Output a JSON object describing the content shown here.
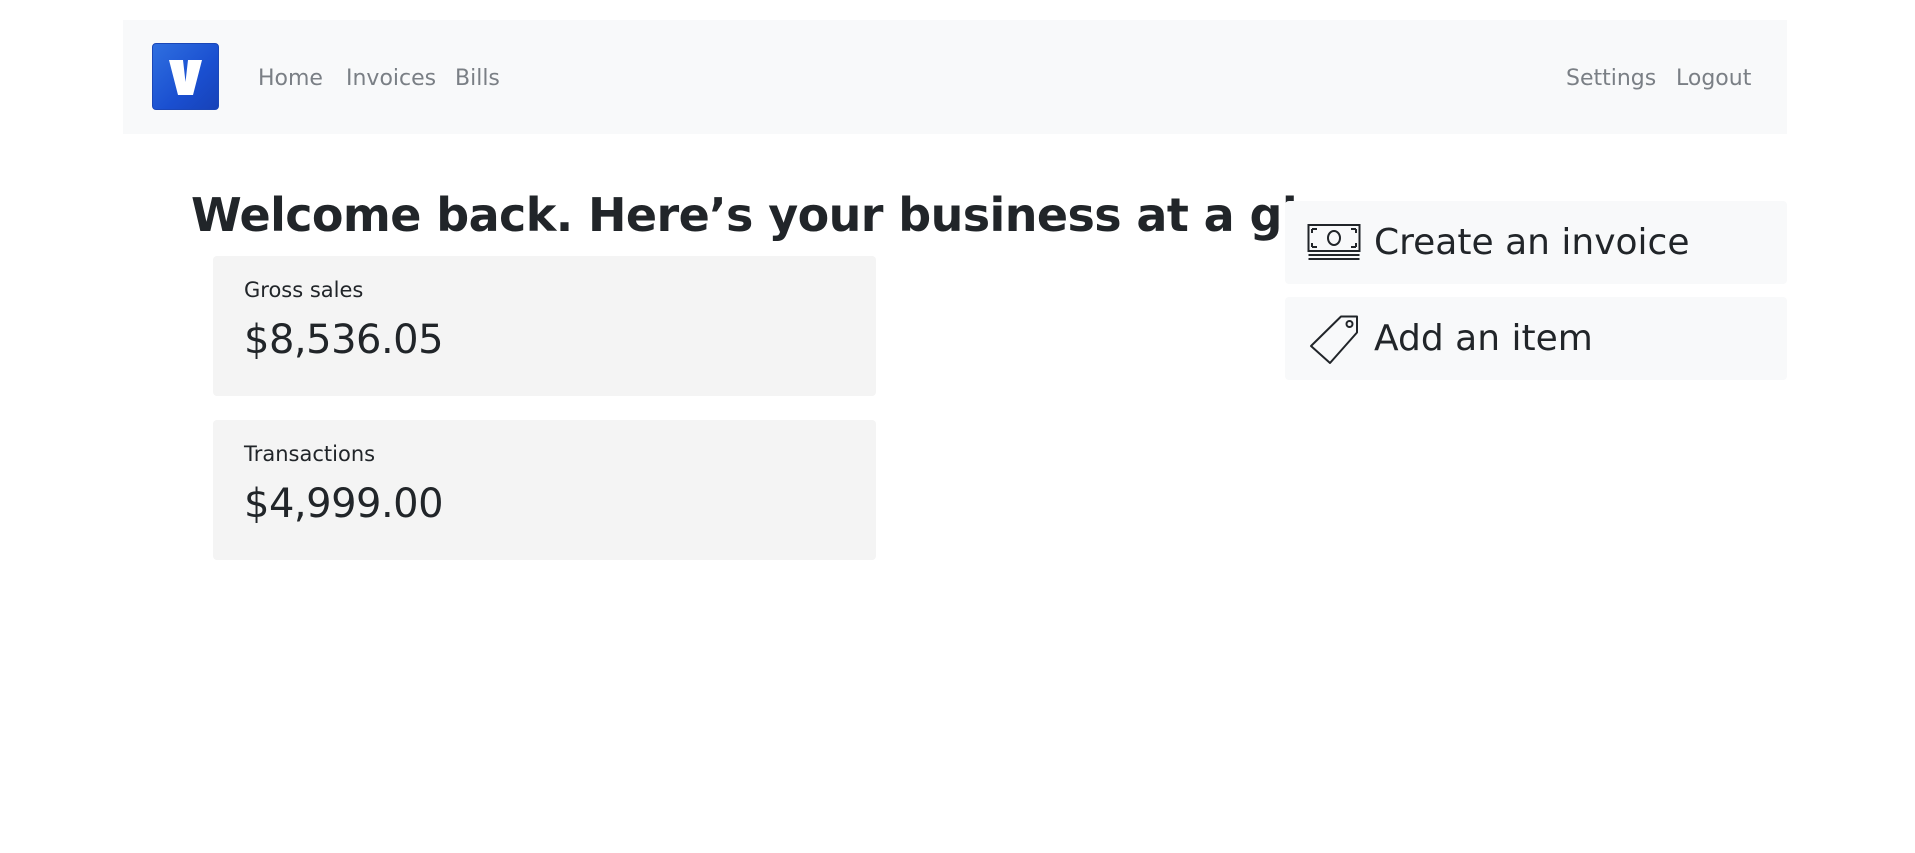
{
  "brand": {
    "logo_letter": "V"
  },
  "nav": {
    "left": [
      {
        "label": "Home"
      },
      {
        "label": "Invoices"
      },
      {
        "label": "Bills"
      }
    ],
    "right": [
      {
        "label": "Settings"
      },
      {
        "label": "Logout"
      }
    ]
  },
  "main": {
    "headline": "Welcome back. Here’s your business at a glance.",
    "stats": [
      {
        "label": "Gross sales",
        "value": "$8,536.05"
      },
      {
        "label": "Transactions",
        "value": "$4,999.00"
      }
    ]
  },
  "actions": [
    {
      "label": "Create an invoice",
      "icon": "cash-icon"
    },
    {
      "label": "Add an item",
      "icon": "tag-icon"
    }
  ],
  "colors": {
    "navbar_bg": "#f8f9fa",
    "logo_blue": "#1a4fd0",
    "nav_link": "#7a7f85",
    "stat_card_bg": "#f4f4f4",
    "text": "#212529"
  }
}
